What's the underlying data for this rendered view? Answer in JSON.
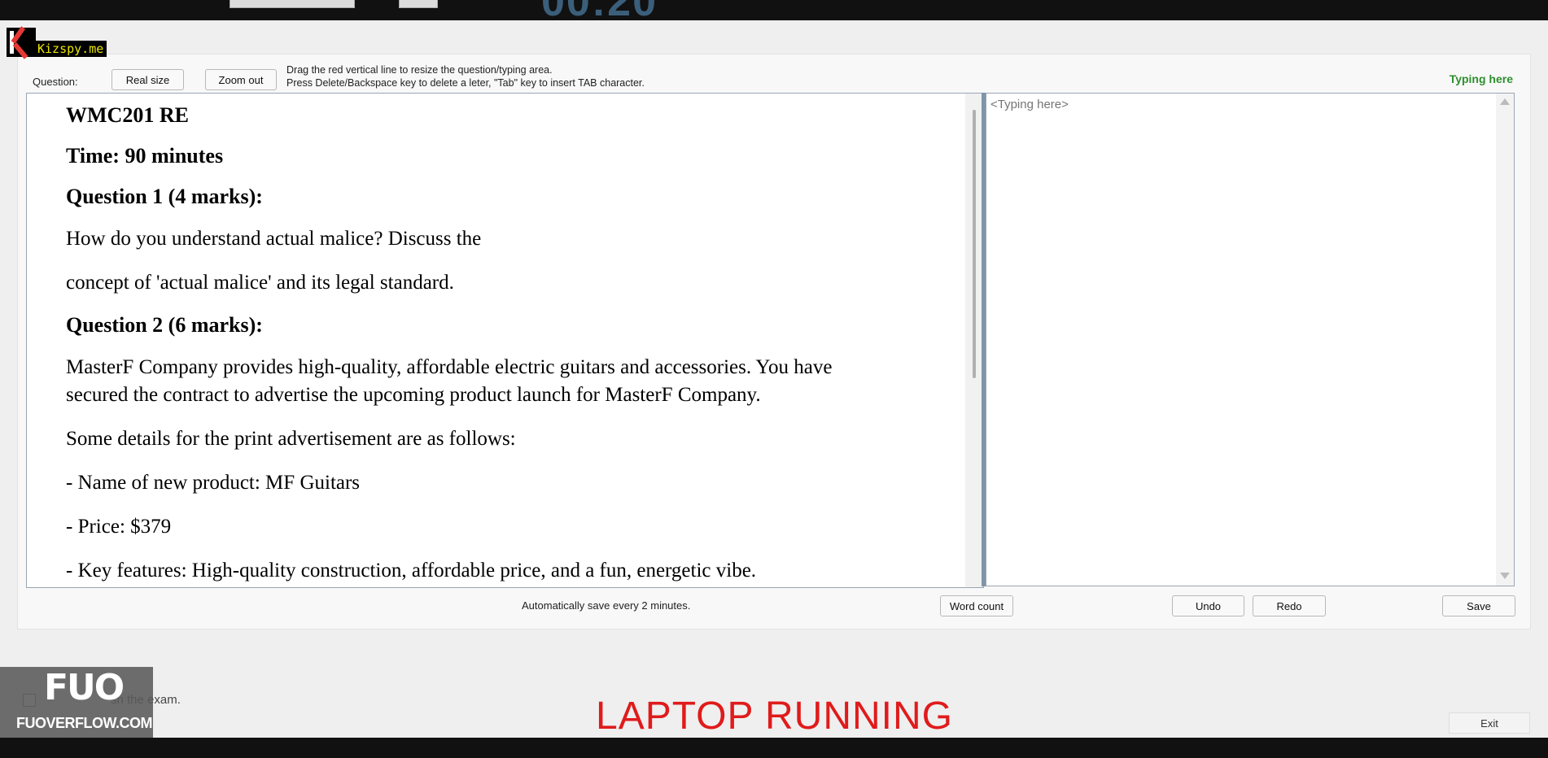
{
  "overlays": {
    "kizspy_label": "Kizspy.me",
    "fuo_logo": "FUO",
    "fuo_site": "FUOVERFLOW.COM",
    "laptop_status": "LAPTOP RUNNING"
  },
  "toolbar": {
    "question_label": "Question:",
    "real_size_label": "Real size",
    "zoom_out_label": "Zoom out",
    "hint_line1": "Drag the red vertical line to resize the question/typing area.",
    "hint_line2": "Press Delete/Backspace key to delete a leter, \"Tab\" key to insert TAB character.",
    "typing_title": "Typing here"
  },
  "question": {
    "course": "WMC201 RE",
    "time": "Time: 90 minutes",
    "q1_heading": "Question 1 (4 marks):",
    "q1_line1": "How do you understand actual malice? Discuss the",
    "q1_line2": "concept of 'actual malice' and its legal standard.",
    "q2_heading": "Question 2 (6 marks):",
    "q2_body": "MasterF Company provides high-quality, affordable electric guitars and accessories. You have secured the contract to advertise the upcoming product launch for MasterF Company.",
    "q2_details_intro": "Some details for the print advertisement are as follows:",
    "q2_detail_name": "- Name of new product: MF Guitars",
    "q2_detail_price": "- Price: $379",
    "q2_detail_features": "- Key features: High-quality construction, affordable price, and a fun, energetic vibe."
  },
  "typing": {
    "placeholder": "<Typing here>"
  },
  "footer": {
    "autosave": "Automatically save every 2 minutes.",
    "word_count_label": "Word count",
    "undo_label": "Undo",
    "redo_label": "Redo",
    "save_label": "Save",
    "finish_label": "sh the exam.",
    "exit_label": "Exit"
  },
  "colors": {
    "typing_title": "#2f8f2f",
    "laptop_status": "#e01b1b",
    "timer": "#3b5f7a",
    "splitter": "#7f95a8"
  }
}
